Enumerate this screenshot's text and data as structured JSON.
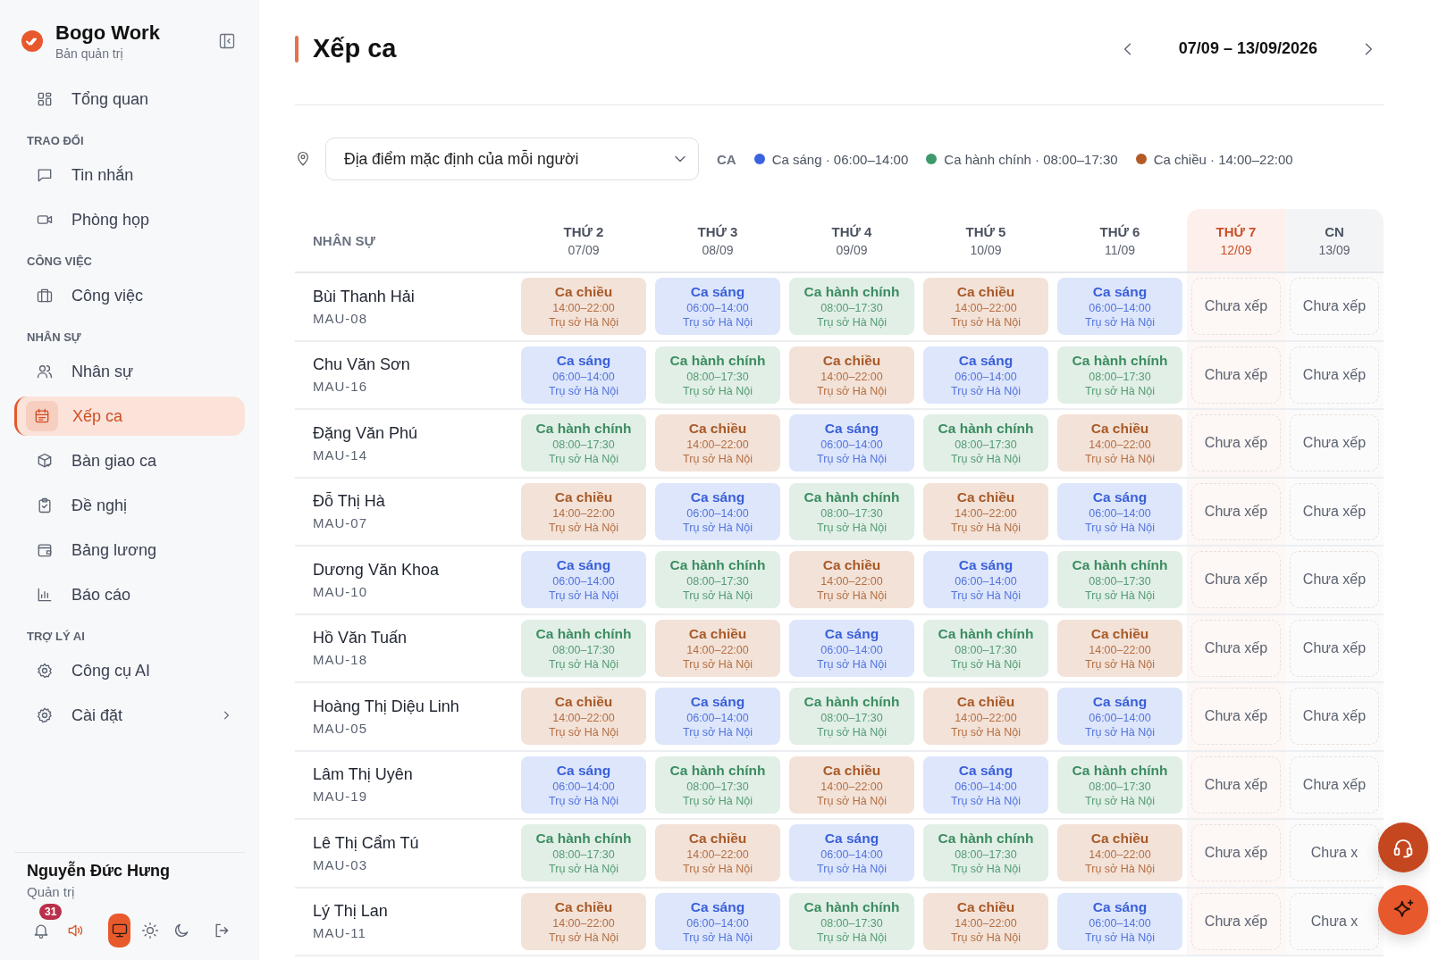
{
  "brand": {
    "name": "Bogo Work",
    "subtitle": "Bản quản trị"
  },
  "nav": [
    {
      "kind": "item",
      "label": "Tổng quan",
      "selected": false
    },
    {
      "kind": "section",
      "label": "TRAO ĐỔI"
    },
    {
      "kind": "item",
      "label": "Tin nhắn",
      "selected": false
    },
    {
      "kind": "item",
      "label": "Phòng họp",
      "selected": false
    },
    {
      "kind": "section",
      "label": "CÔNG VIỆC"
    },
    {
      "kind": "item",
      "label": "Công việc",
      "selected": false
    },
    {
      "kind": "section",
      "label": "NHÂN SỰ"
    },
    {
      "kind": "item",
      "label": "Nhân sự",
      "selected": false
    },
    {
      "kind": "item",
      "label": "Xếp ca",
      "selected": true
    },
    {
      "kind": "item",
      "label": "Bàn giao ca",
      "selected": false
    },
    {
      "kind": "item",
      "label": "Đề nghị",
      "selected": false
    },
    {
      "kind": "item",
      "label": "Bảng lương",
      "selected": false
    },
    {
      "kind": "item",
      "label": "Báo cáo",
      "selected": false
    },
    {
      "kind": "section",
      "label": "TRỢ LÝ AI"
    },
    {
      "kind": "item",
      "label": "Công cụ AI",
      "selected": false
    },
    {
      "kind": "item",
      "label": "Cài đặt",
      "selected": false,
      "submenu": true
    }
  ],
  "user": {
    "name": "Nguyễn Đức Hưng",
    "role": "Quản trị",
    "notifications": "31",
    "sound_on": true,
    "themes": [
      {
        "selected": true
      },
      {
        "selected": false
      },
      {
        "selected": false
      }
    ]
  },
  "page": {
    "title": "Xếp ca",
    "week": "07/09 – 13/09/2026"
  },
  "filter": {
    "location": "Địa điểm mặc định của mỗi người",
    "legend_label": "CA",
    "legend": [
      {
        "text": "Ca sáng · 06:00–14:00",
        "color": "#3b63e0"
      },
      {
        "text": "Ca hành chính · 08:00–17:30",
        "color": "#3f9a6b"
      },
      {
        "text": "Ca chiều · 14:00–22:00",
        "color": "#b35a26"
      }
    ]
  },
  "table": {
    "first_column": "NHÂN SỰ",
    "days": [
      {
        "name": "THỨ 2",
        "date": "07/09",
        "highlighted": false,
        "weekend": false
      },
      {
        "name": "THỨ 3",
        "date": "08/09",
        "highlighted": false,
        "weekend": false
      },
      {
        "name": "THỨ 4",
        "date": "09/09",
        "highlighted": false,
        "weekend": false
      },
      {
        "name": "THỨ 5",
        "date": "10/09",
        "highlighted": false,
        "weekend": false
      },
      {
        "name": "THỨ 6",
        "date": "11/09",
        "highlighted": false,
        "weekend": false
      },
      {
        "name": "THỨ 7",
        "date": "12/09",
        "highlighted": true,
        "weekend": true
      },
      {
        "name": "CN",
        "date": "13/09",
        "highlighted": false,
        "weekend": true
      }
    ],
    "rows": [
      {
        "name": "Bùi Thanh Hải",
        "code": "MAU-08",
        "cells": [
          {
            "kind": "afternoon",
            "name": "Ca chiều",
            "time": "14:00–22:00",
            "place": "Trụ sở Hà Nội"
          },
          {
            "kind": "morning",
            "name": "Ca sáng",
            "time": "06:00–14:00",
            "place": "Trụ sở Hà Nội"
          },
          {
            "kind": "office",
            "name": "Ca hành chính",
            "time": "08:00–17:30",
            "place": "Trụ sở Hà Nội"
          },
          {
            "kind": "afternoon",
            "name": "Ca chiều",
            "time": "14:00–22:00",
            "place": "Trụ sở Hà Nội"
          },
          {
            "kind": "morning",
            "name": "Ca sáng",
            "time": "06:00–14:00",
            "place": "Trụ sở Hà Nội"
          },
          {
            "kind": "empty",
            "name": "Chưa xếp"
          },
          {
            "kind": "empty",
            "name": "Chưa xếp"
          }
        ]
      },
      {
        "name": "Chu Văn Sơn",
        "code": "MAU-16",
        "cells": [
          {
            "kind": "morning",
            "name": "Ca sáng",
            "time": "06:00–14:00",
            "place": "Trụ sở Hà Nội"
          },
          {
            "kind": "office",
            "name": "Ca hành chính",
            "time": "08:00–17:30",
            "place": "Trụ sở Hà Nội"
          },
          {
            "kind": "afternoon",
            "name": "Ca chiều",
            "time": "14:00–22:00",
            "place": "Trụ sở Hà Nội"
          },
          {
            "kind": "morning",
            "name": "Ca sáng",
            "time": "06:00–14:00",
            "place": "Trụ sở Hà Nội"
          },
          {
            "kind": "office",
            "name": "Ca hành chính",
            "time": "08:00–17:30",
            "place": "Trụ sở Hà Nội"
          },
          {
            "kind": "empty",
            "name": "Chưa xếp"
          },
          {
            "kind": "empty",
            "name": "Chưa xếp"
          }
        ]
      },
      {
        "name": "Đặng Văn Phú",
        "code": "MAU-14",
        "cells": [
          {
            "kind": "office",
            "name": "Ca hành chính",
            "time": "08:00–17:30",
            "place": "Trụ sở Hà Nội"
          },
          {
            "kind": "afternoon",
            "name": "Ca chiều",
            "time": "14:00–22:00",
            "place": "Trụ sở Hà Nội"
          },
          {
            "kind": "morning",
            "name": "Ca sáng",
            "time": "06:00–14:00",
            "place": "Trụ sở Hà Nội"
          },
          {
            "kind": "office",
            "name": "Ca hành chính",
            "time": "08:00–17:30",
            "place": "Trụ sở Hà Nội"
          },
          {
            "kind": "afternoon",
            "name": "Ca chiều",
            "time": "14:00–22:00",
            "place": "Trụ sở Hà Nội"
          },
          {
            "kind": "empty",
            "name": "Chưa xếp"
          },
          {
            "kind": "empty",
            "name": "Chưa xếp"
          }
        ]
      },
      {
        "name": "Đỗ Thị Hà",
        "code": "MAU-07",
        "cells": [
          {
            "kind": "afternoon",
            "name": "Ca chiều",
            "time": "14:00–22:00",
            "place": "Trụ sở Hà Nội"
          },
          {
            "kind": "morning",
            "name": "Ca sáng",
            "time": "06:00–14:00",
            "place": "Trụ sở Hà Nội"
          },
          {
            "kind": "office",
            "name": "Ca hành chính",
            "time": "08:00–17:30",
            "place": "Trụ sở Hà Nội"
          },
          {
            "kind": "afternoon",
            "name": "Ca chiều",
            "time": "14:00–22:00",
            "place": "Trụ sở Hà Nội"
          },
          {
            "kind": "morning",
            "name": "Ca sáng",
            "time": "06:00–14:00",
            "place": "Trụ sở Hà Nội"
          },
          {
            "kind": "empty",
            "name": "Chưa xếp"
          },
          {
            "kind": "empty",
            "name": "Chưa xếp"
          }
        ]
      },
      {
        "name": "Dương Văn Khoa",
        "code": "MAU-10",
        "cells": [
          {
            "kind": "morning",
            "name": "Ca sáng",
            "time": "06:00–14:00",
            "place": "Trụ sở Hà Nội"
          },
          {
            "kind": "office",
            "name": "Ca hành chính",
            "time": "08:00–17:30",
            "place": "Trụ sở Hà Nội"
          },
          {
            "kind": "afternoon",
            "name": "Ca chiều",
            "time": "14:00–22:00",
            "place": "Trụ sở Hà Nội"
          },
          {
            "kind": "morning",
            "name": "Ca sáng",
            "time": "06:00–14:00",
            "place": "Trụ sở Hà Nội"
          },
          {
            "kind": "office",
            "name": "Ca hành chính",
            "time": "08:00–17:30",
            "place": "Trụ sở Hà Nội"
          },
          {
            "kind": "empty",
            "name": "Chưa xếp"
          },
          {
            "kind": "empty",
            "name": "Chưa xếp"
          }
        ]
      },
      {
        "name": "Hồ Văn Tuấn",
        "code": "MAU-18",
        "cells": [
          {
            "kind": "office",
            "name": "Ca hành chính",
            "time": "08:00–17:30",
            "place": "Trụ sở Hà Nội"
          },
          {
            "kind": "afternoon",
            "name": "Ca chiều",
            "time": "14:00–22:00",
            "place": "Trụ sở Hà Nội"
          },
          {
            "kind": "morning",
            "name": "Ca sáng",
            "time": "06:00–14:00",
            "place": "Trụ sở Hà Nội"
          },
          {
            "kind": "office",
            "name": "Ca hành chính",
            "time": "08:00–17:30",
            "place": "Trụ sở Hà Nội"
          },
          {
            "kind": "afternoon",
            "name": "Ca chiều",
            "time": "14:00–22:00",
            "place": "Trụ sở Hà Nội"
          },
          {
            "kind": "empty",
            "name": "Chưa xếp"
          },
          {
            "kind": "empty",
            "name": "Chưa xếp"
          }
        ]
      },
      {
        "name": "Hoàng Thị Diệu Linh",
        "code": "MAU-05",
        "cells": [
          {
            "kind": "afternoon",
            "name": "Ca chiều",
            "time": "14:00–22:00",
            "place": "Trụ sở Hà Nội"
          },
          {
            "kind": "morning",
            "name": "Ca sáng",
            "time": "06:00–14:00",
            "place": "Trụ sở Hà Nội"
          },
          {
            "kind": "office",
            "name": "Ca hành chính",
            "time": "08:00–17:30",
            "place": "Trụ sở Hà Nội"
          },
          {
            "kind": "afternoon",
            "name": "Ca chiều",
            "time": "14:00–22:00",
            "place": "Trụ sở Hà Nội"
          },
          {
            "kind": "morning",
            "name": "Ca sáng",
            "time": "06:00–14:00",
            "place": "Trụ sở Hà Nội"
          },
          {
            "kind": "empty",
            "name": "Chưa xếp"
          },
          {
            "kind": "empty",
            "name": "Chưa xếp"
          }
        ]
      },
      {
        "name": "Lâm Thị Uyên",
        "code": "MAU-19",
        "cells": [
          {
            "kind": "morning",
            "name": "Ca sáng",
            "time": "06:00–14:00",
            "place": "Trụ sở Hà Nội"
          },
          {
            "kind": "office",
            "name": "Ca hành chính",
            "time": "08:00–17:30",
            "place": "Trụ sở Hà Nội"
          },
          {
            "kind": "afternoon",
            "name": "Ca chiều",
            "time": "14:00–22:00",
            "place": "Trụ sở Hà Nội"
          },
          {
            "kind": "morning",
            "name": "Ca sáng",
            "time": "06:00–14:00",
            "place": "Trụ sở Hà Nội"
          },
          {
            "kind": "office",
            "name": "Ca hành chính",
            "time": "08:00–17:30",
            "place": "Trụ sở Hà Nội"
          },
          {
            "kind": "empty",
            "name": "Chưa xếp"
          },
          {
            "kind": "empty",
            "name": "Chưa xếp"
          }
        ]
      },
      {
        "name": "Lê Thị Cẩm Tú",
        "code": "MAU-03",
        "cells": [
          {
            "kind": "office",
            "name": "Ca hành chính",
            "time": "08:00–17:30",
            "place": "Trụ sở Hà Nội"
          },
          {
            "kind": "afternoon",
            "name": "Ca chiều",
            "time": "14:00–22:00",
            "place": "Trụ sở Hà Nội"
          },
          {
            "kind": "morning",
            "name": "Ca sáng",
            "time": "06:00–14:00",
            "place": "Trụ sở Hà Nội"
          },
          {
            "kind": "office",
            "name": "Ca hành chính",
            "time": "08:00–17:30",
            "place": "Trụ sở Hà Nội"
          },
          {
            "kind": "afternoon",
            "name": "Ca chiều",
            "time": "14:00–22:00",
            "place": "Trụ sở Hà Nội"
          },
          {
            "kind": "empty",
            "name": "Chưa xếp"
          },
          {
            "kind": "empty",
            "name": "Chưa x"
          }
        ]
      },
      {
        "name": "Lý Thị Lan",
        "code": "MAU-11",
        "cells": [
          {
            "kind": "afternoon",
            "name": "Ca chiều",
            "time": "14:00–22:00",
            "place": "Trụ sở Hà Nội"
          },
          {
            "kind": "morning",
            "name": "Ca sáng",
            "time": "06:00–14:00",
            "place": "Trụ sở Hà Nội"
          },
          {
            "kind": "office",
            "name": "Ca hành chính",
            "time": "08:00–17:30",
            "place": "Trụ sở Hà Nội"
          },
          {
            "kind": "afternoon",
            "name": "Ca chiều",
            "time": "14:00–22:00",
            "place": "Trụ sở Hà Nội"
          },
          {
            "kind": "morning",
            "name": "Ca sáng",
            "time": "06:00–14:00",
            "place": "Trụ sở Hà Nội"
          },
          {
            "kind": "empty",
            "name": "Chưa xếp"
          },
          {
            "kind": "empty",
            "name": "Chưa x"
          }
        ]
      }
    ]
  }
}
